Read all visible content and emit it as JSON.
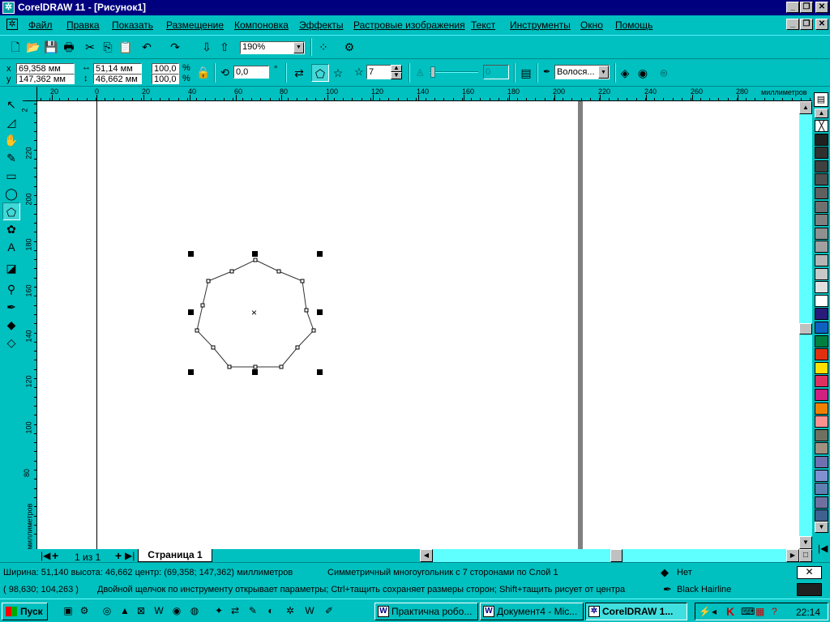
{
  "window": {
    "title": "CorelDRAW 11 - [Рисунок1]"
  },
  "menu": [
    "Файл",
    "Правка",
    "Показать",
    "Размещение",
    "Компоновка",
    "Эффекты",
    "Растровые изображения",
    "Текст",
    "Инструменты",
    "Окно",
    "Помощь"
  ],
  "toolbar": {
    "zoom": "190%"
  },
  "propbar": {
    "x_label": "x",
    "x": "69,358 мм",
    "y_label": "y",
    "y": "147,362 мм",
    "w": "51,14 мм",
    "h": "46,662 мм",
    "scale_x": "100,0",
    "scale_y": "100,0",
    "pct": "%",
    "angle": "0,0",
    "deg": "°",
    "points": "7",
    "sharpness": "0",
    "outline": "Волося..."
  },
  "ruler": {
    "h_ticks": [
      "20",
      "0",
      "20",
      "40",
      "60",
      "80",
      "100",
      "120",
      "140",
      "160",
      "180",
      "200",
      "220",
      "240",
      "260",
      "280"
    ],
    "h_unit": "миллиметров",
    "v_ticks": [
      "2",
      "220",
      "200",
      "180",
      "160",
      "140",
      "120",
      "100",
      "80"
    ],
    "v_unit": "миллиметров"
  },
  "pages": {
    "counter": "1 из 1",
    "tab": "Страница 1"
  },
  "status": {
    "line1_dims": "Ширина: 51,140  высота: 46,662  центр: (69,358; 147,362)  миллиметров",
    "line1_obj": "Симметричный многоугольник с 7 сторонами по Слой 1",
    "line2_coords": "( 98,630; 104,263 )",
    "line2_hint": "Двойной щелчок по инструменту открывает параметры; Ctrl+тащить сохраняет размеры сторон; Shift+тащить рисует от центра",
    "fill": "Нет",
    "outline": "Black  Hairline"
  },
  "taskbar": {
    "start": "Пуск",
    "tasks": [
      "Практична робо...",
      "Документ4 - Mic...",
      "CorelDRAW 1..."
    ],
    "clock": "22:14"
  },
  "palette": [
    "#ffffff",
    "#202020",
    "#303030",
    "#404040",
    "#505050",
    "#606060",
    "#707070",
    "#808080",
    "#909090",
    "#a0a0a0",
    "#b4b4b4",
    "#c8c8c8",
    "#e0e0e0",
    "#ffffff",
    "#2a1a7a",
    "#1060c0",
    "#008040",
    "#e03010",
    "#ffe000",
    "#e03060",
    "#d02080",
    "#f08000",
    "#ff9090",
    "#707060",
    "#a09080",
    "#7070b0",
    "#8090d0",
    "#6080b0",
    "#7070a0",
    "#406090"
  ],
  "colors": {
    "desktop": "#00c0c0",
    "title": "#00007f"
  }
}
